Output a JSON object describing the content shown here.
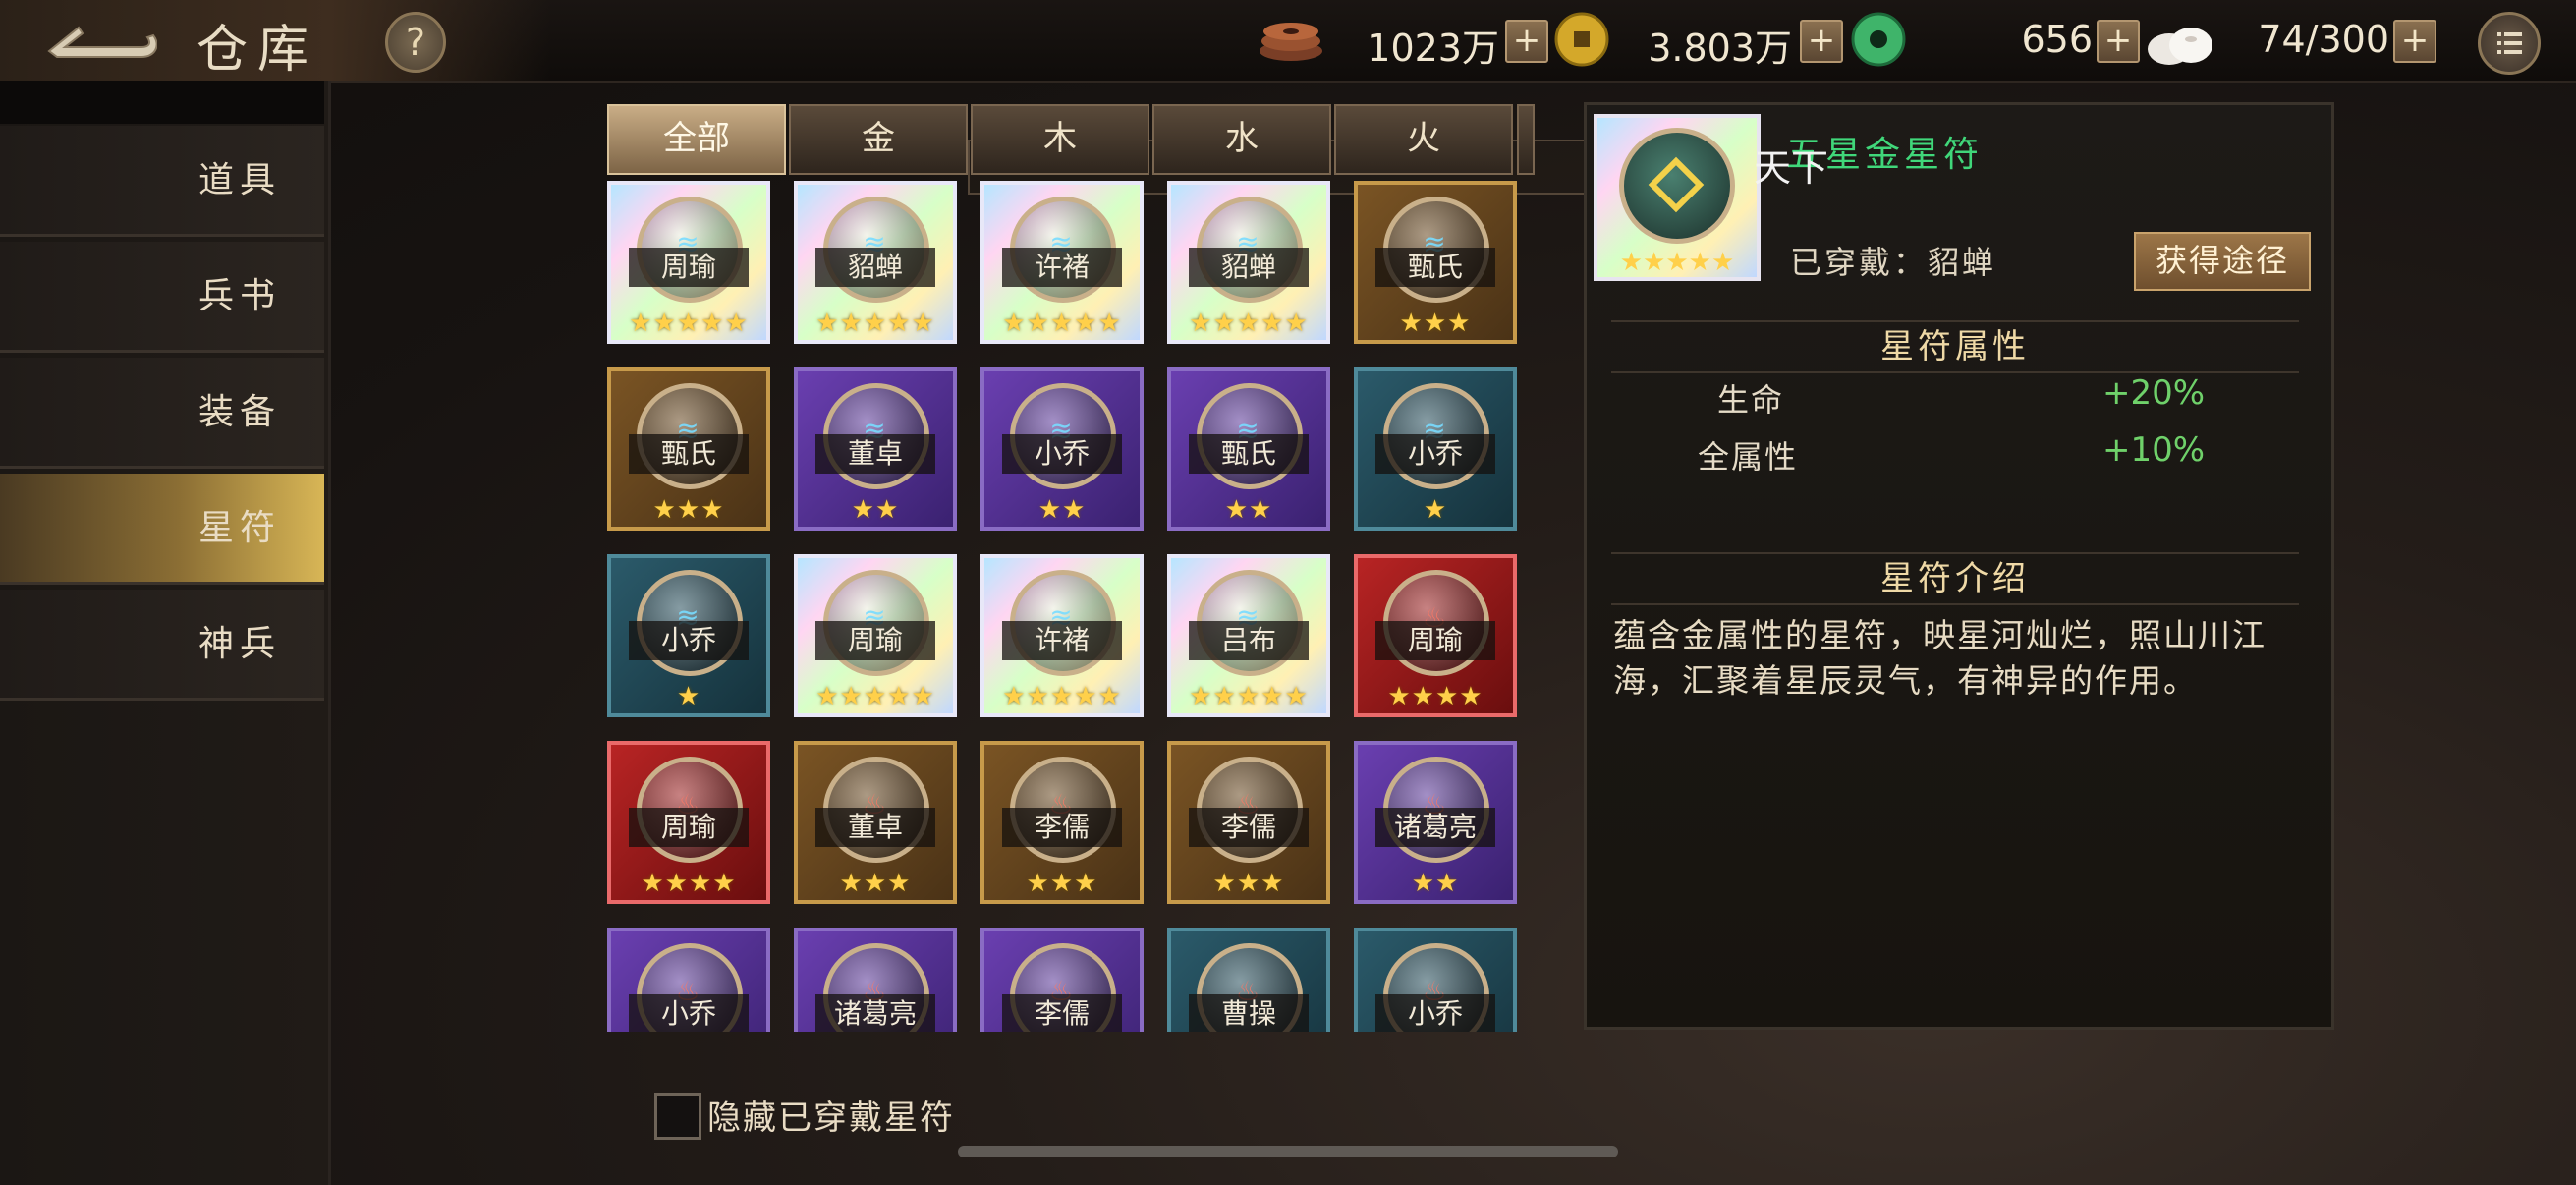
{
  "header": {
    "title": "仓库",
    "help_label": "?",
    "resources": [
      {
        "icon": "coin-stack-icon",
        "value": "1023万"
      },
      {
        "icon": "gold-coin-icon",
        "value": "3.803万"
      },
      {
        "icon": "jade-icon",
        "value": "656"
      },
      {
        "icon": "steamed-bun-icon",
        "value": "74/300"
      }
    ],
    "plus_label": "+"
  },
  "sidebar": {
    "items": [
      {
        "label": "道具"
      },
      {
        "label": "兵书"
      },
      {
        "label": "装备"
      },
      {
        "label": "星符",
        "active": true
      },
      {
        "label": "神兵"
      }
    ]
  },
  "tabs": [
    {
      "label": "全部",
      "active": true
    },
    {
      "label": "金"
    },
    {
      "label": "木"
    },
    {
      "label": "水"
    },
    {
      "label": "火"
    }
  ],
  "grid": {
    "rows": [
      [
        {
          "name": "周瑜",
          "quality": "rainbow",
          "stars": "★★★★★",
          "glyph": "≋"
        },
        {
          "name": "貂蝉",
          "quality": "rainbow",
          "stars": "★★★★★",
          "glyph": "≋"
        },
        {
          "name": "许褚",
          "quality": "rainbow",
          "stars": "★★★★★",
          "glyph": "≋"
        },
        {
          "name": "貂蝉",
          "quality": "rainbow",
          "stars": "★★★★★",
          "glyph": "≋"
        },
        {
          "name": "甄氏",
          "quality": "gold",
          "stars": "★★★",
          "glyph": "≋"
        }
      ],
      [
        {
          "name": "甄氏",
          "quality": "gold",
          "stars": "★★★",
          "glyph": "≋"
        },
        {
          "name": "董卓",
          "quality": "purple",
          "stars": "★★",
          "glyph": "≋"
        },
        {
          "name": "小乔",
          "quality": "purple",
          "stars": "★★",
          "glyph": "≋"
        },
        {
          "name": "甄氏",
          "quality": "purple",
          "stars": "★★",
          "glyph": "≋"
        },
        {
          "name": "小乔",
          "quality": "teal",
          "stars": "★",
          "glyph": "≋"
        }
      ],
      [
        {
          "name": "小乔",
          "quality": "teal",
          "stars": "★",
          "glyph": "≋"
        },
        {
          "name": "周瑜",
          "quality": "rainbow",
          "stars": "★★★★★",
          "glyph": "≋"
        },
        {
          "name": "许褚",
          "quality": "rainbow",
          "stars": "★★★★★",
          "glyph": "≋"
        },
        {
          "name": "吕布",
          "quality": "rainbow",
          "stars": "★★★★★",
          "glyph": "≋"
        },
        {
          "name": "周瑜",
          "quality": "red",
          "stars": "★★★★",
          "glyph": "♨"
        }
      ],
      [
        {
          "name": "周瑜",
          "quality": "red",
          "stars": "★★★★",
          "glyph": "♨"
        },
        {
          "name": "董卓",
          "quality": "gold",
          "stars": "★★★",
          "glyph": "♨"
        },
        {
          "name": "李儒",
          "quality": "gold",
          "stars": "★★★",
          "glyph": "♨"
        },
        {
          "name": "李儒",
          "quality": "gold",
          "stars": "★★★",
          "glyph": "♨"
        },
        {
          "name": "诸葛亮",
          "quality": "purple",
          "stars": "★★",
          "glyph": "♨"
        }
      ],
      [
        {
          "name": "小乔",
          "quality": "purple",
          "stars": "",
          "glyph": "♨"
        },
        {
          "name": "诸葛亮",
          "quality": "purple",
          "stars": "",
          "glyph": "♨"
        },
        {
          "name": "李儒",
          "quality": "purple",
          "stars": "",
          "glyph": "♨"
        },
        {
          "name": "曹操",
          "quality": "teal",
          "stars": "",
          "glyph": "♨"
        },
        {
          "name": "小乔",
          "quality": "teal",
          "stars": "",
          "glyph": "♨"
        }
      ]
    ]
  },
  "hide_worn": {
    "label": "隐藏已穿戴星符",
    "checked": false
  },
  "detail": {
    "name": "五星金星符",
    "overlay_text": "天下",
    "stars": "★★★★★",
    "worn_by": "已穿戴：貂蝉",
    "source_button": "获得途径",
    "attr_header": "星符属性",
    "attributes": [
      {
        "name": "生命",
        "value": "+20%"
      },
      {
        "name": "全属性",
        "value": "+10%"
      }
    ],
    "intro_header": "星符介绍",
    "description": "蕴含金属性的星符，映星河灿烂，照山川江海，汇聚着星辰灵气，有神异的作用。"
  },
  "colors": {
    "accent_gold": "#d8b656",
    "name_green": "#40d77a",
    "value_green": "#6fd16a"
  }
}
